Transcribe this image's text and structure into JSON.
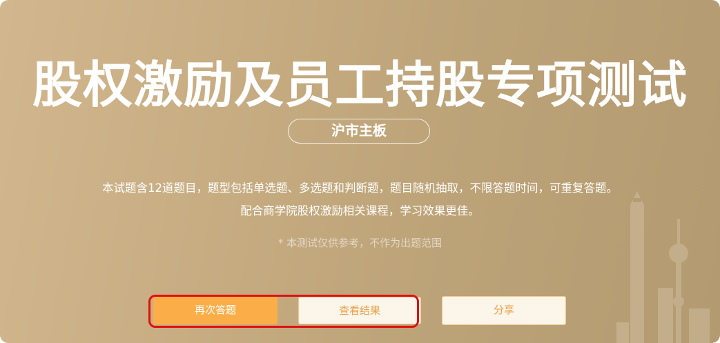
{
  "quiz": {
    "title": "股权激励及员工持股专项测试",
    "board": "沪市主板",
    "description_line1": "本试题含12道题目，题型包括单选题、多选题和判断题，题目随机抽取，不限答题时间，可重复答题。",
    "description_line2": "配合商学院股权激励相关课程，学习效果更佳。",
    "note": "* 本测试仅供参考，不作为出题范围"
  },
  "actions": {
    "retry_label": "再次答题",
    "view_result_label": "查看结果",
    "share_label": "分享"
  },
  "colors": {
    "background_start": "#d2b78e",
    "background_end": "#b49a70",
    "primary_button": "#fbae48",
    "secondary_button_bg": "#fbf5ea",
    "secondary_button_text": "#e8a24a",
    "highlight_outline": "#e01010"
  },
  "icons": {
    "background_decoration": "city-skyline-icon"
  }
}
